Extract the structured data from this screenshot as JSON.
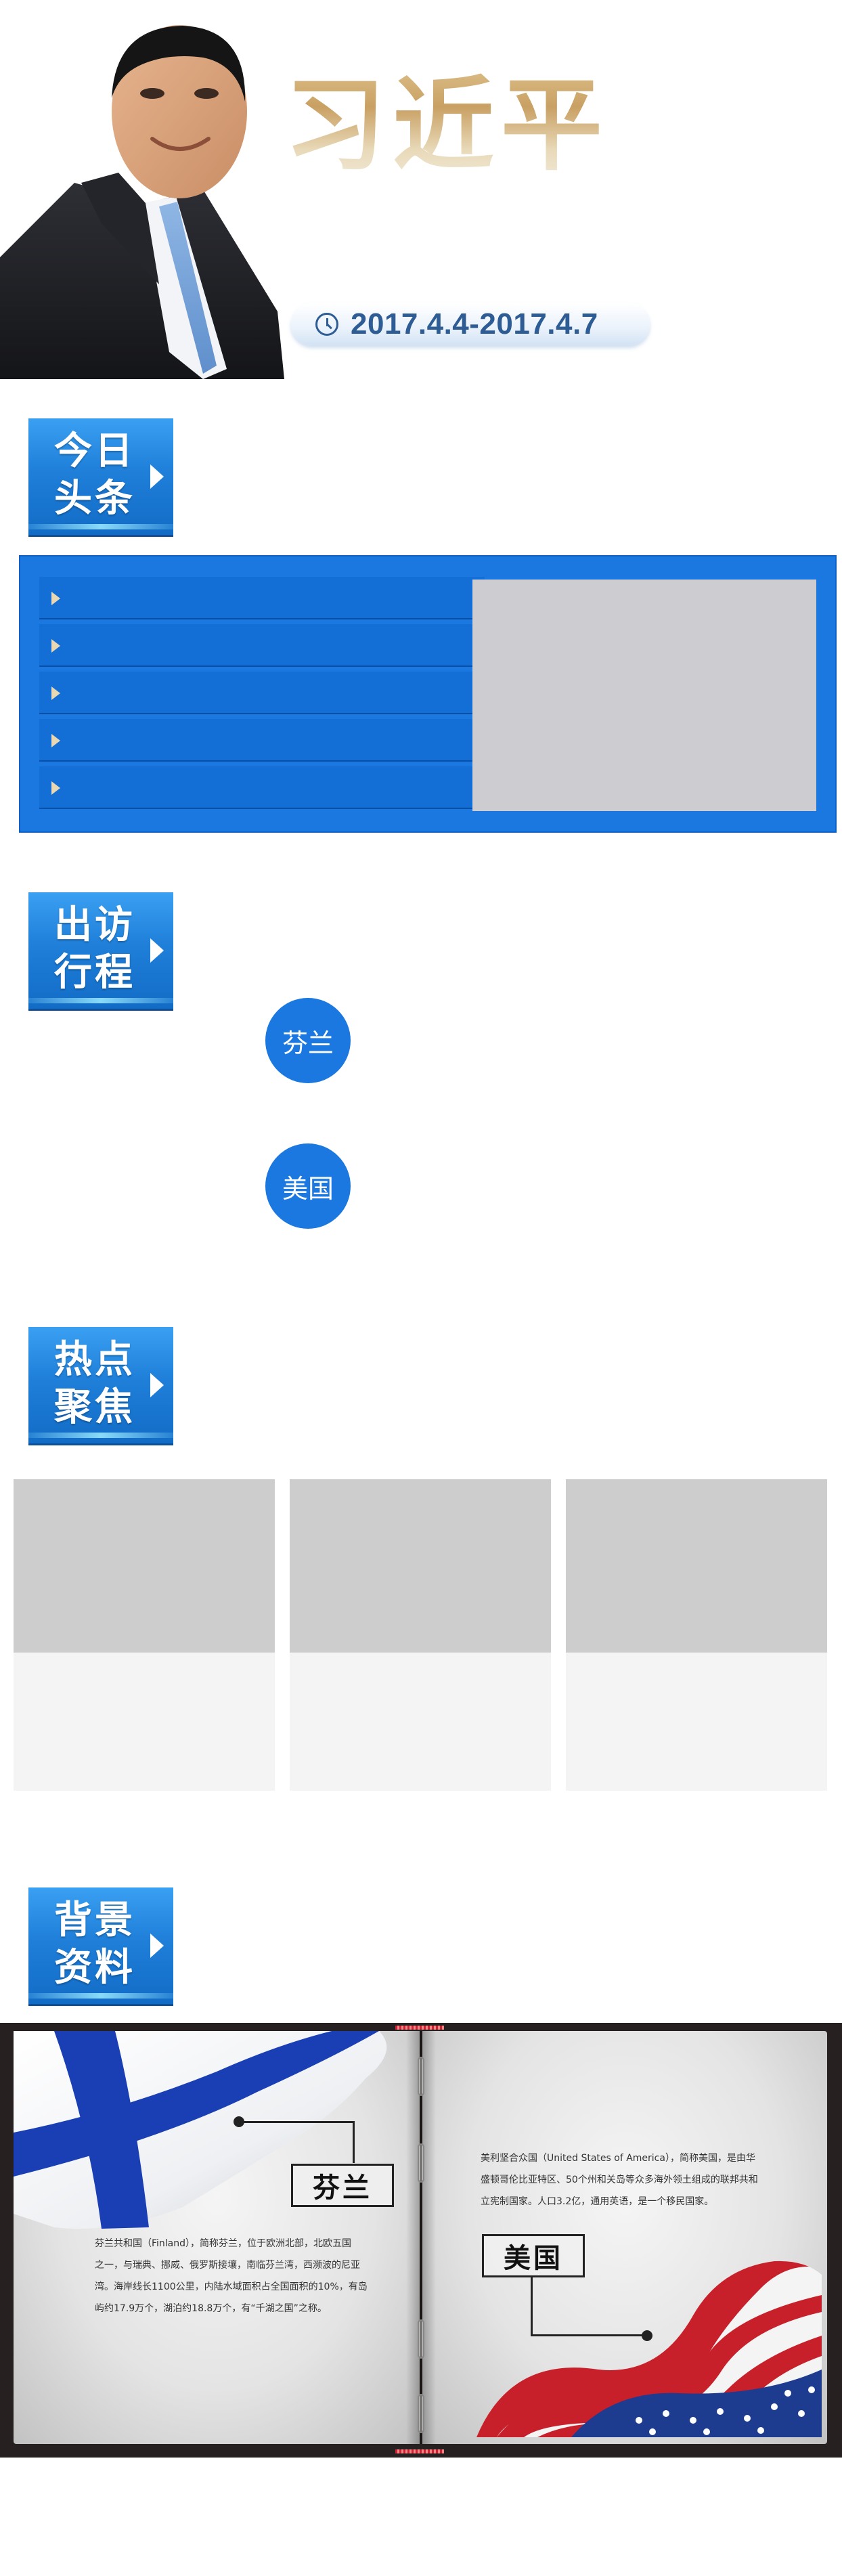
{
  "header": {
    "name": "习近平",
    "date_range": "2017.4.4-2017.4.7"
  },
  "sections": {
    "headlines": {
      "badge": "今日\n头条",
      "line1": "今日",
      "line2": "头条"
    },
    "itinerary": {
      "line1": "出访",
      "line2": "行程"
    },
    "hot_focus": {
      "line1": "热点",
      "line2": "聚焦"
    },
    "background": {
      "line1": "背景",
      "line2": "资料"
    }
  },
  "headlines": {
    "items": [
      {
        "title": ""
      },
      {
        "title": ""
      },
      {
        "title": ""
      },
      {
        "title": ""
      },
      {
        "title": ""
      }
    ]
  },
  "itinerary": {
    "stops": [
      {
        "label": "芬兰"
      },
      {
        "label": "美国"
      }
    ]
  },
  "hot_focus": {
    "cards": [
      {
        "title": ""
      },
      {
        "title": ""
      },
      {
        "title": ""
      }
    ]
  },
  "background_info": {
    "finland": {
      "label": "芬兰",
      "desc_lines": [
        "芬兰共和国（Finland），简称芬兰，位于欧洲北部，北欧五国",
        "之一，与瑞典、挪威、俄罗斯接壤，南临芬兰湾，西濒波的尼亚",
        "湾。海岸线长1100公里，内陆水域面积占全国面积的10%，有岛",
        "屿约17.9万个，湖泊约18.8万个，有“千湖之国”之称。"
      ]
    },
    "usa": {
      "label": "美国",
      "desc_lines": [
        "美利坚合众国（United States of America），简称美国，是由华",
        "盛顿哥伦比亚特区、50个州和关岛等众多海外领土组成的联邦共和",
        "立宪制国家。人口3.2亿，通用英语，是一个移民国家。"
      ]
    }
  },
  "colors": {
    "primary_blue": "#1a78e0",
    "title_gold": "#c9a063",
    "date_blue": "#2e5d95"
  }
}
